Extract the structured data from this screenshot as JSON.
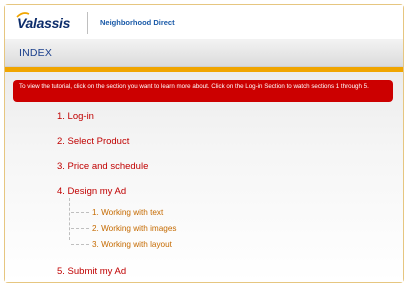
{
  "header": {
    "logo_text": "Valassis",
    "brand_text": "Neighborhood Direct"
  },
  "section": {
    "title": "INDEX"
  },
  "notice": {
    "text": "To view the tutorial, click on the section you want to learn more about. Click on the Log-in Section to watch sections 1 through 5."
  },
  "menu": {
    "items": [
      {
        "label": "1. Log-in"
      },
      {
        "label": "2. Select Product"
      },
      {
        "label": "3. Price and schedule"
      },
      {
        "label": "4. Design my Ad"
      },
      {
        "label": "5. Submit my Ad"
      }
    ],
    "subitems": [
      {
        "label": "1. Working with text"
      },
      {
        "label": "2. Working with images"
      },
      {
        "label": "3. Working with layout"
      }
    ]
  },
  "colors": {
    "accent_orange": "#f0a500",
    "notice_red": "#cc0000",
    "menu_red": "#c00000",
    "submenu_orange": "#c56a00",
    "title_blue": "#1a3f8c"
  }
}
